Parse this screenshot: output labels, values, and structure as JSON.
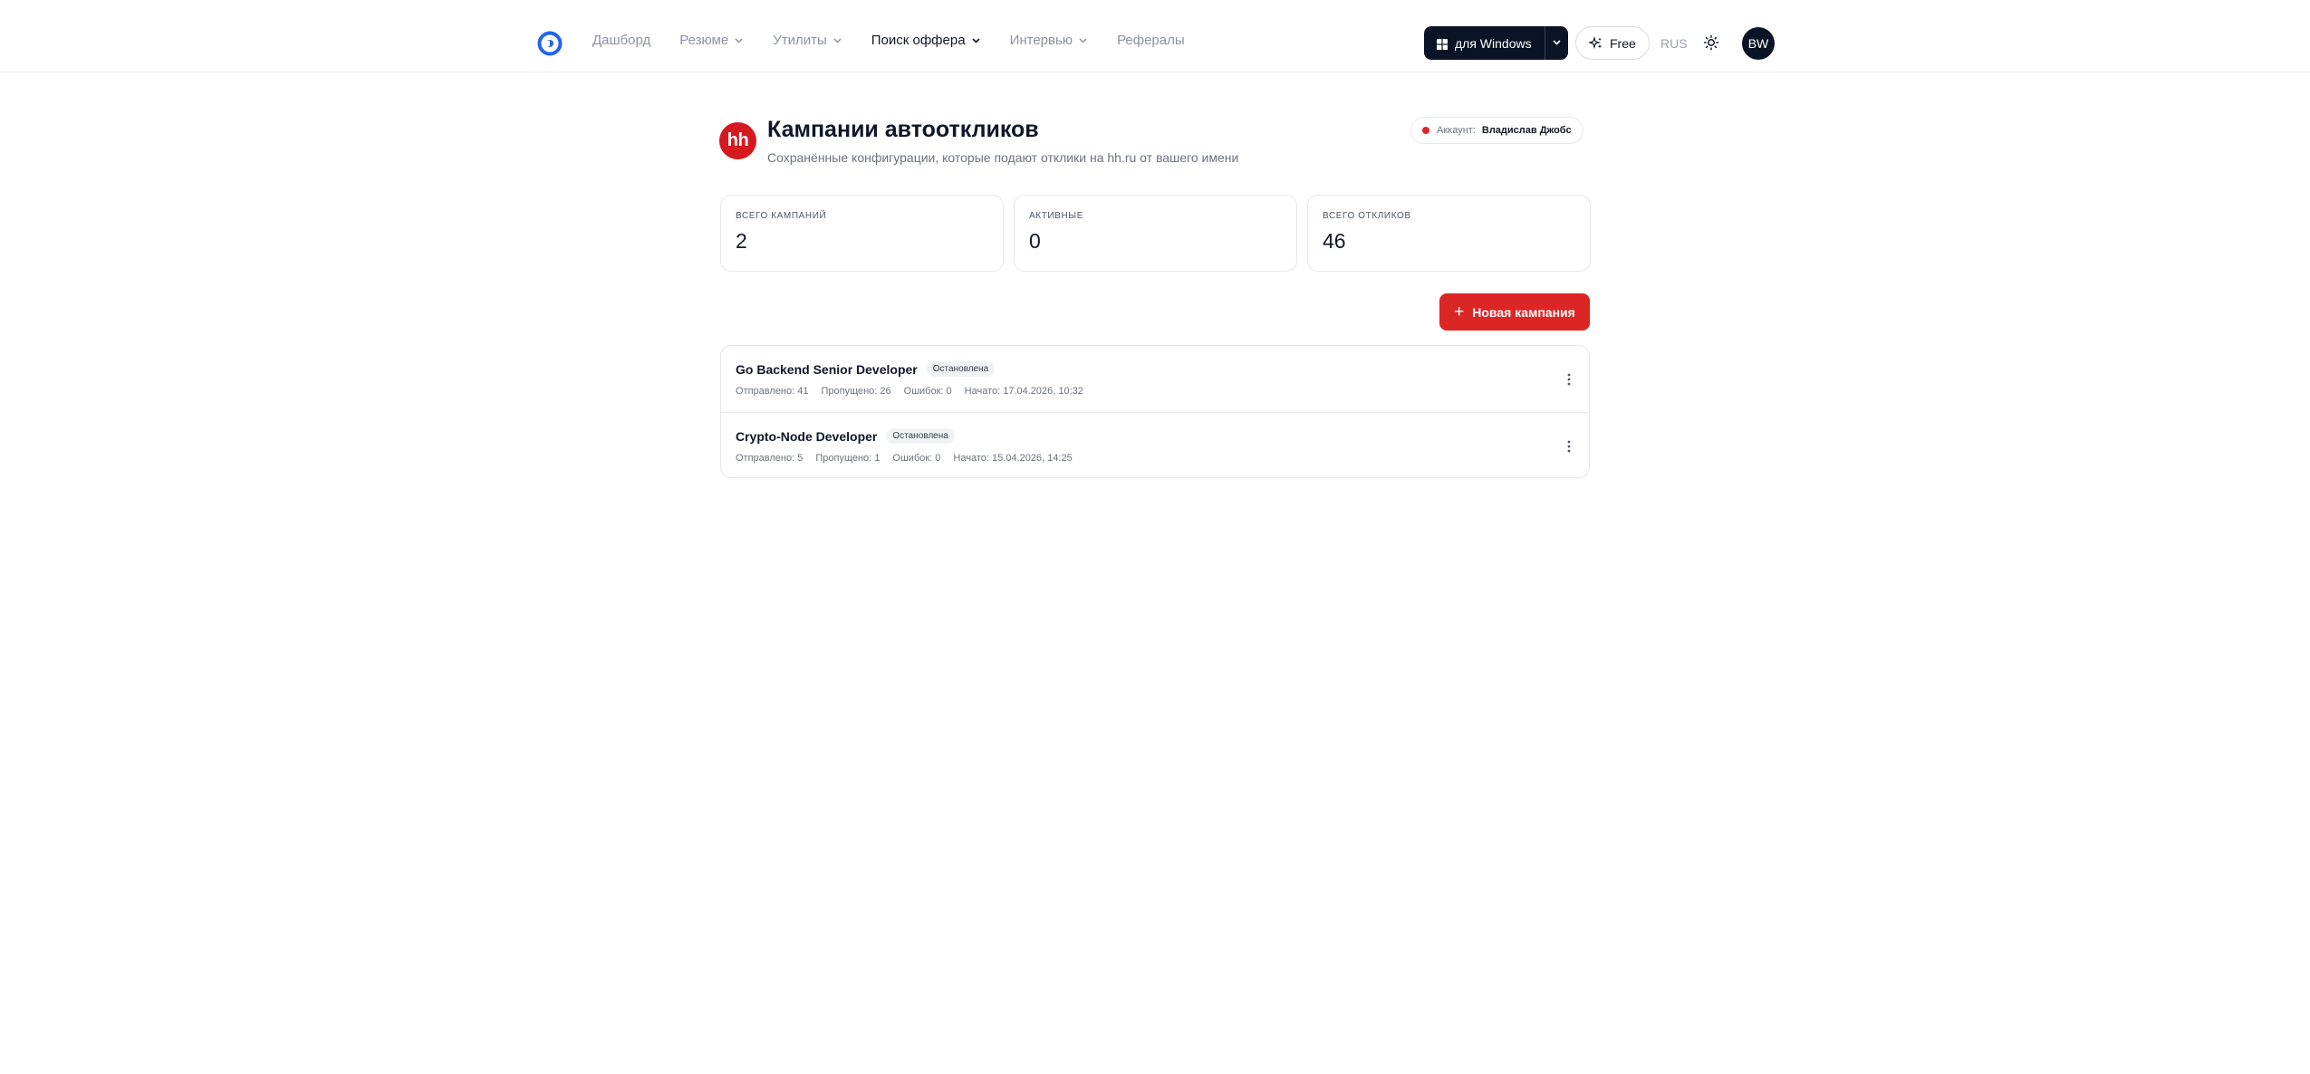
{
  "nav": {
    "items": [
      {
        "label": "Дашборд",
        "has_dropdown": false,
        "active": false
      },
      {
        "label": "Резюме",
        "has_dropdown": true,
        "active": false
      },
      {
        "label": "Утилиты",
        "has_dropdown": true,
        "active": false
      },
      {
        "label": "Поиск оффера",
        "has_dropdown": true,
        "active": true
      },
      {
        "label": "Интервью",
        "has_dropdown": true,
        "active": false
      },
      {
        "label": "Рефералы",
        "has_dropdown": false,
        "active": false
      }
    ],
    "download_label": "для Windows",
    "plan_label": "Free",
    "language": "RUS",
    "avatar_initials": "BW"
  },
  "header": {
    "logo_text": "hh",
    "title": "Кампании автооткликов",
    "subtitle": "Сохранённые конфигурации, которые подают отклики на hh.ru от вашего имени",
    "account_label": "Аккаунт:",
    "account_name": "Владислав Джобс"
  },
  "stats": [
    {
      "label": "Всего кампаний",
      "value": "2"
    },
    {
      "label": "Активные",
      "value": "0"
    },
    {
      "label": "Всего откликов",
      "value": "46"
    }
  ],
  "new_campaign_label": "Новая кампания",
  "campaigns": [
    {
      "title": "Go Backend Senior Developer",
      "status": "Остановлена",
      "sent": "Отправлено: 41",
      "skipped": "Пропущено: 26",
      "errors": "Ошибок: 0",
      "started": "Начато: 17.04.2026, 10:32"
    },
    {
      "title": "Crypto-Node Developer",
      "status": "Остановлена",
      "sent": "Отправлено: 5",
      "skipped": "Пропущено: 1",
      "errors": "Ошибок: 0",
      "started": "Начато: 15.04.2026, 14:25"
    }
  ],
  "colors": {
    "accent_red": "#dc2626",
    "brand_blue": "#2563eb",
    "dark": "#0b1426",
    "status_dot": "#e02424"
  }
}
